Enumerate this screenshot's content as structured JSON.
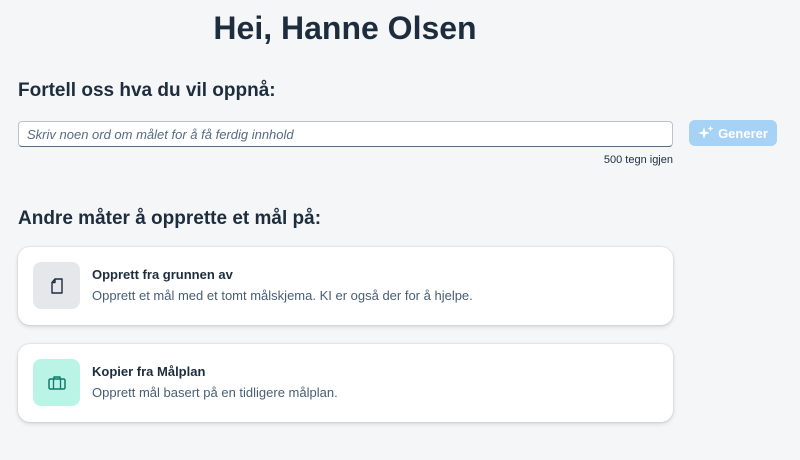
{
  "header": {
    "greeting": "Hei, Hanne Olsen"
  },
  "goal_prompt": {
    "heading": "Fortell oss hva du vil oppnå:",
    "input_value": "",
    "input_placeholder": "Skriv noen ord om målet for å få ferdig innhold",
    "char_counter": "500 tegn igjen",
    "generate_label": "Generer",
    "generate_icon": "sparkle-icon"
  },
  "alternatives": {
    "heading": "Andre måter å opprette et mål på:",
    "cards": [
      {
        "title": "Opprett fra grunnen av",
        "description": "Opprett et mål med et tomt målskjema. KI er også der for å hjelpe.",
        "icon": "blank-document-icon"
      },
      {
        "title": "Kopier fra Målplan",
        "description": "Opprett mål basert på en tidligere målplan.",
        "icon": "briefcase-icon"
      }
    ]
  },
  "colors": {
    "background": "#f5f6f7",
    "text": "#1d2d3e",
    "button_disabled": "#a6d2f5",
    "tile_grey": "#e5e7ea",
    "tile_mint": "#b9f4e6",
    "icon_mint": "#0f7a6b"
  }
}
